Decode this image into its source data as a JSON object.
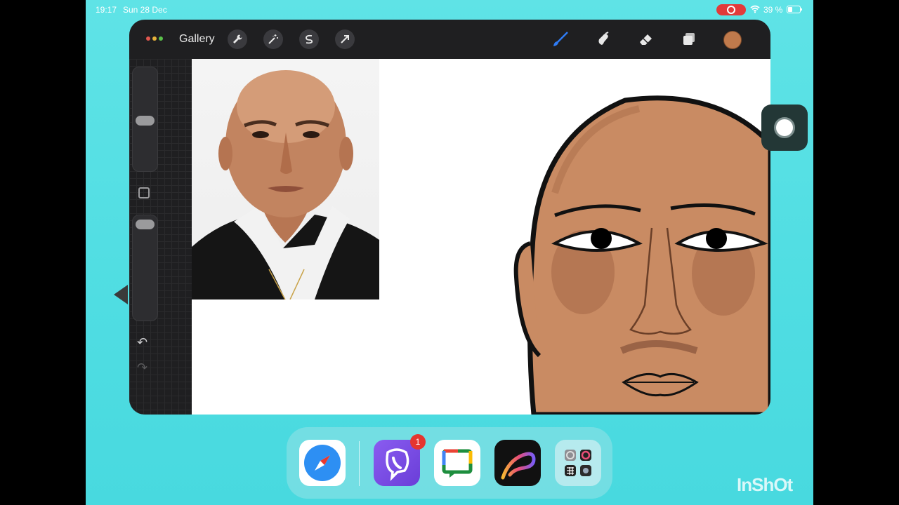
{
  "status": {
    "time": "19:17",
    "date": "Sun 28 Dec",
    "battery": "39 %"
  },
  "toolbar": {
    "gallery_label": "Gallery",
    "actions": [
      "wrench-icon",
      "magic-wand-icon",
      "selection-icon",
      "transform-arrow-icon"
    ],
    "tools": [
      "brush-icon",
      "smudge-icon",
      "eraser-icon",
      "layers-icon"
    ],
    "active_tool": "brush",
    "current_color": "#c07a4c"
  },
  "sidebar": {
    "brush_size": 0.5,
    "opacity": 0.1
  },
  "dock": {
    "apps": [
      "Safari",
      "Viber",
      "Google Chat",
      "Procreate",
      "Utilities folder"
    ],
    "viber_badge": "1"
  },
  "watermark": "InShOt"
}
